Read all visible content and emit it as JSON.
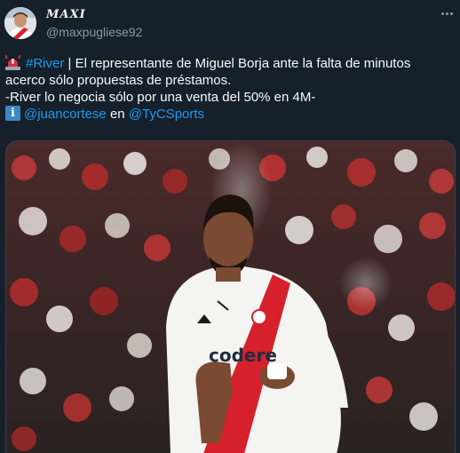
{
  "author": {
    "display_name": "MAXI",
    "handle": "@maxpugliese92",
    "avatar_icon": "profile-photo-avatar"
  },
  "menu": {
    "icon": "more-options-icon"
  },
  "tweet": {
    "line1": {
      "emoji": "rotating-light-emoji",
      "hashtag": "#River",
      "text": " | El representante de Miguel Borja ante la falta de minutos"
    },
    "line2": "acerco sólo propuestas de préstamos.",
    "line3": "-River lo negocia sólo por una venta del 50% en 4M-",
    "line4": {
      "emoji": "information-emoji",
      "mention1": "@juancortese",
      "connector": " en ",
      "mention2": "@TyCSports"
    }
  },
  "media": {
    "description_icon": "football-player-photo",
    "jersey_sponsor": "codere"
  },
  "colors": {
    "background": "#15202b",
    "text": "#f7f9f9",
    "secondary_text": "#8b98a5",
    "link": "#1d9bf0",
    "jersey_red": "#d6202c"
  }
}
